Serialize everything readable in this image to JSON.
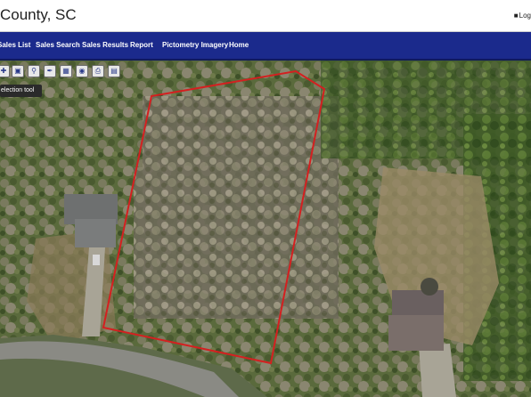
{
  "header": {
    "title": "County, SC",
    "user_label": "Log"
  },
  "nav": {
    "items": [
      {
        "label": "Sales List"
      },
      {
        "label": "Sales Search"
      },
      {
        "label": "Sales Results"
      },
      {
        "label": "Report"
      },
      {
        "label": "Pictometry Imagery"
      },
      {
        "label": "Home"
      }
    ]
  },
  "toolbar": {
    "tools": [
      {
        "icon": "pan-icon"
      },
      {
        "icon": "selection-tool-icon"
      },
      {
        "icon": "zoom-icon"
      },
      {
        "icon": "measure-icon"
      },
      {
        "icon": "layers-icon"
      },
      {
        "icon": "identify-icon"
      },
      {
        "icon": "print-icon"
      },
      {
        "icon": "save-icon"
      }
    ],
    "tooltip": "election tool"
  },
  "colors": {
    "nav_background": "#1b2a8c",
    "parcel_outline": "#d42020"
  }
}
